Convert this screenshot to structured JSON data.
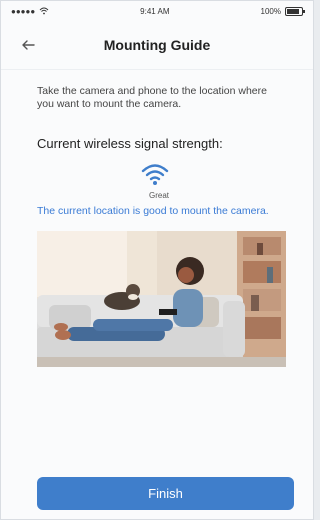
{
  "status_bar": {
    "carrier": "●●●●● ",
    "time": "9:41 AM",
    "battery": "100%"
  },
  "header": {
    "title": "Mounting Guide",
    "back_icon": "arrow-left-icon"
  },
  "content": {
    "instructions": "Take the camera and phone to the location where you want to mount the camera.",
    "signal_heading": "Current wireless signal strength:",
    "signal_icon": "wifi-icon",
    "signal_label": "Great",
    "signal_message": "The current location is good to mount the camera."
  },
  "footer": {
    "finish_label": "Finish"
  },
  "colors": {
    "accent": "#3f7ecb",
    "message": "#3a7bd5"
  }
}
